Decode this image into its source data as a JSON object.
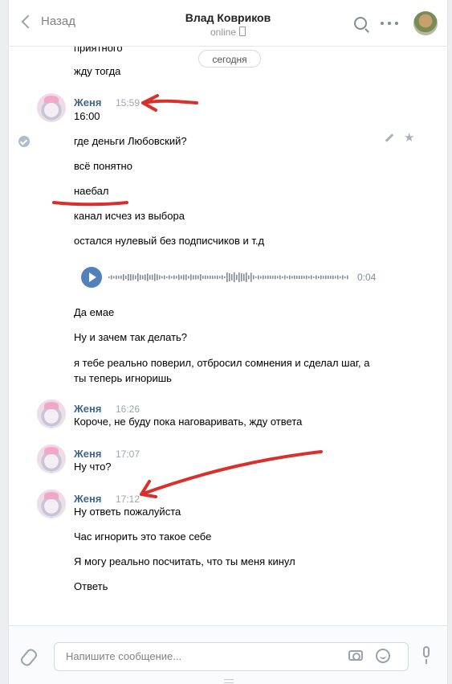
{
  "header": {
    "back_label": "Назад",
    "title": "Влад Ковриков",
    "status": "online"
  },
  "date_divider": "сегодня",
  "top_fragment": [
    "приятного",
    "жду тогда"
  ],
  "messages": [
    {
      "author": "Женя",
      "time": "15:59",
      "lines": [
        "16:00",
        "где деньги Любовский?",
        "всё понятно",
        "наебал",
        "канал исчез из выбора",
        "остался нулевый без подписчиков и т.д"
      ],
      "voice_duration": "0:04",
      "after_voice": [
        "Да емае",
        "Ну и зачем так делать?",
        "я тебе реально поверил, отбросил сомнения и сделал шаг, а ты теперь игноришь"
      ]
    },
    {
      "author": "Женя",
      "time": "16:26",
      "lines": [
        "Короче, не буду пока наговаривать, жду ответа"
      ]
    },
    {
      "author": "Женя",
      "time": "17:07",
      "lines": [
        "Ну что?"
      ]
    },
    {
      "author": "Женя",
      "time": "17:12",
      "lines": [
        "Ну ответь пожалуйста",
        "Час игнорить это такое себе",
        "Я могу реально посчитать, что ты меня кинул",
        "Ответь"
      ]
    }
  ],
  "composer": {
    "placeholder": "Напишите сообщение..."
  },
  "colors": {
    "name": "#42648b",
    "accent": "#5181b8",
    "annotation": "#d9302c"
  },
  "icons": [
    "back-chevron-icon",
    "phone-icon",
    "search-icon",
    "more-icon",
    "check-icon",
    "edit-icon",
    "star-icon",
    "play-icon",
    "attach-icon",
    "camera-icon",
    "emoji-icon",
    "microphone-icon"
  ]
}
